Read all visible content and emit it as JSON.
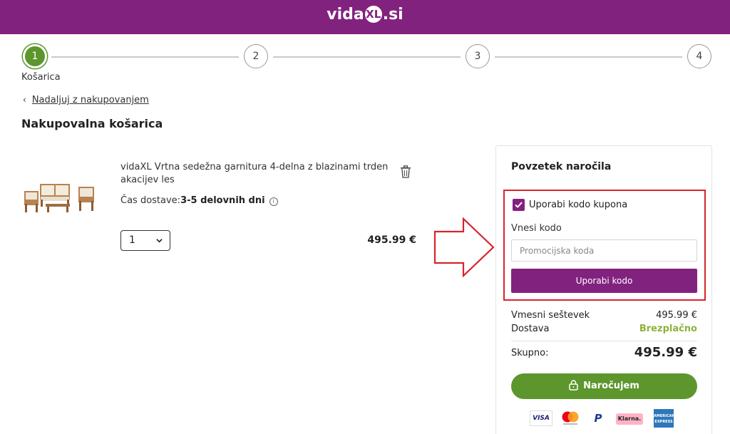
{
  "header": {
    "logo_left": "vida",
    "logo_mark": "XL",
    "logo_right": ".si",
    "bg_color": "#82227f"
  },
  "steps": {
    "items": [
      {
        "number": "1",
        "active": true
      },
      {
        "number": "2",
        "active": false
      },
      {
        "number": "3",
        "active": false
      },
      {
        "number": "4",
        "active": false
      }
    ],
    "active_label": "Košarica"
  },
  "nav": {
    "back_chevron": "‹",
    "back_label": "Nadaljuj z nakupovanjem"
  },
  "page": {
    "title": "Nakupovalna košarica"
  },
  "cart": {
    "product_name": "vidaXL Vrtna sedežna garnitura 4-delna z blazinami trden akacijev les",
    "delivery_label": "Čas dostave:",
    "delivery_value": "3-5 delovnih dni",
    "info_icon_glyph": "i",
    "quantity": "1",
    "price": "495.99 €"
  },
  "summary": {
    "title": "Povzetek naročila",
    "use_coupon_label": "Uporabi kodo kupona",
    "use_coupon_checked": true,
    "code_label": "Vnesi kodo",
    "code_placeholder": "Promocijska koda",
    "apply_button": "Uporabi kodo",
    "subtotal_label": "Vmesni seštevek",
    "subtotal_value": "495.99 €",
    "shipping_label": "Dostava",
    "shipping_value": "Brezplačno",
    "total_label": "Skupno:",
    "total_value": "495.99 €",
    "order_button": "Naročujem"
  },
  "payments": {
    "visa": "VISA",
    "paypal": "P",
    "klarna": "Klarna.",
    "amex_line1": "AMERICAN",
    "amex_line2": "EXPRESS"
  },
  "colors": {
    "brand": "#82227f",
    "accent_green": "#5c962d",
    "free_green": "#8db33b",
    "highlight_red": "#d9232c"
  }
}
